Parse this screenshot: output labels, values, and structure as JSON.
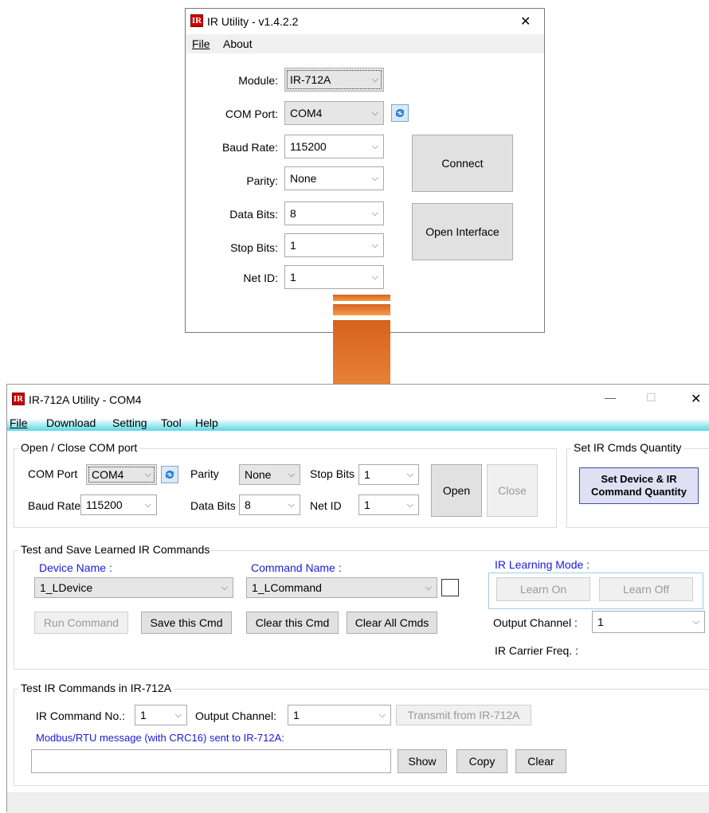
{
  "top_window": {
    "title": "IR Utility - v1.4.2.2",
    "menu": [
      "File",
      "About"
    ],
    "fields": {
      "module_label": "Module:",
      "module_value": "IR-712A",
      "com_label": "COM Port:",
      "com_value": "COM4",
      "baud_label": "Baud Rate:",
      "baud_value": "115200",
      "parity_label": "Parity:",
      "parity_value": "None",
      "databits_label": "Data Bits:",
      "databits_value": "8",
      "stopbits_label": "Stop Bits:",
      "stopbits_value": "1",
      "netid_label": "Net ID:",
      "netid_value": "1"
    },
    "connect_label": "Connect",
    "open_interface_label": "Open Interface",
    "close_glyph": "✕"
  },
  "bottom_window": {
    "title": "IR-712A Utility - COM4",
    "menu": [
      "File",
      "Download",
      "Setting",
      "Tool",
      "Help"
    ],
    "controls": {
      "min": "—",
      "max": "☐",
      "close": "✕"
    },
    "com_group": {
      "title": "Open / Close COM port",
      "com_label": "COM Port",
      "com_value": "COM4",
      "parity_label": "Parity",
      "parity_value": "None",
      "stopbits_label": "Stop Bits",
      "stopbits_value": "1",
      "baud_label": "Baud Rate",
      "baud_value": "115200",
      "databits_label": "Data Bits",
      "databits_value": "8",
      "netid_label": "Net ID",
      "netid_value": "1",
      "open_label": "Open",
      "close_label": "Close"
    },
    "qty_group": {
      "title": "Set IR Cmds Quantity",
      "button_label_1": "Set Device & IR",
      "button_label_2": "Command Quantity"
    },
    "learn_group": {
      "title": "Test and Save Learned IR Commands",
      "device_name_label": "Device Name :",
      "device_name_value": "1_LDevice",
      "command_name_label": "Command Name :",
      "command_name_value": "1_LCommand",
      "learning_mode_label": "IR Learning Mode :",
      "learn_on": "Learn On",
      "learn_off": "Learn Off",
      "run_cmd": "Run Command",
      "save_cmd": "Save this Cmd",
      "clear_cmd": "Clear this Cmd",
      "clear_all": "Clear All Cmds",
      "output_channel_label": "Output Channel :",
      "output_channel_value": "1",
      "carrier_label": "IR Carrier Freq. :"
    },
    "test_group": {
      "title": "Test IR Commands in IR-712A",
      "cmd_no_label": "IR Command No.:",
      "cmd_no_value": "1",
      "output_channel_label": "Output Channel:",
      "output_channel_value": "1",
      "transmit": "Transmit from IR-712A",
      "modbus_label": "Modbus/RTU message (with CRC16) sent to IR-712A:",
      "modbus_value": "",
      "show": "Show",
      "copy": "Copy",
      "clear": "Clear"
    }
  },
  "colors": {
    "arrow": "#e8762b",
    "accent_blue": "#1a1adb",
    "menu_gradient_end": "#5ad8e6"
  }
}
